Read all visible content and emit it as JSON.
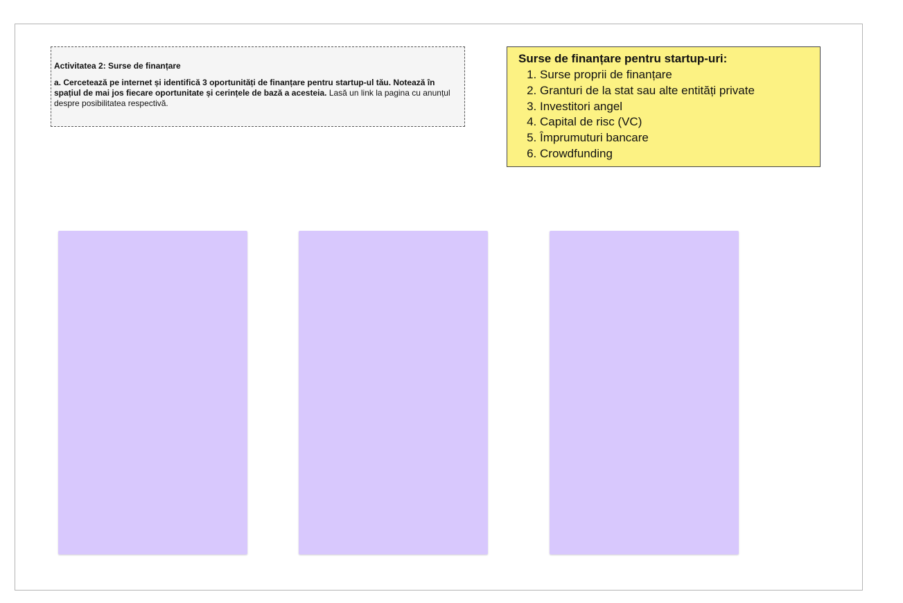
{
  "instructions": {
    "title": "Activitatea 2: Surse de finanțare",
    "task_bold": "a. Cercetează pe internet și identifică 3 oportunități de finanțare pentru startup-ul tău. Notează în spațiul de mai jos fiecare oportunitate și cerințele de bază a acesteia.",
    "task_regular": " Lasă un link la pagina cu anunțul despre posibilitatea respectivă."
  },
  "sources": {
    "heading": "Surse de finanțare pentru startup-uri:",
    "items": [
      "Surse proprii de finanțare",
      "Granturi de la stat sau alte entități private",
      "Investitori angel",
      "Capital de risc (VC)",
      "Împrumuturi bancare",
      "Crowdfunding"
    ]
  },
  "colors": {
    "sticky_yellow": "#fcf283",
    "sticky_purple": "#d8c8fd",
    "instruction_bg": "#f5f5f5"
  }
}
